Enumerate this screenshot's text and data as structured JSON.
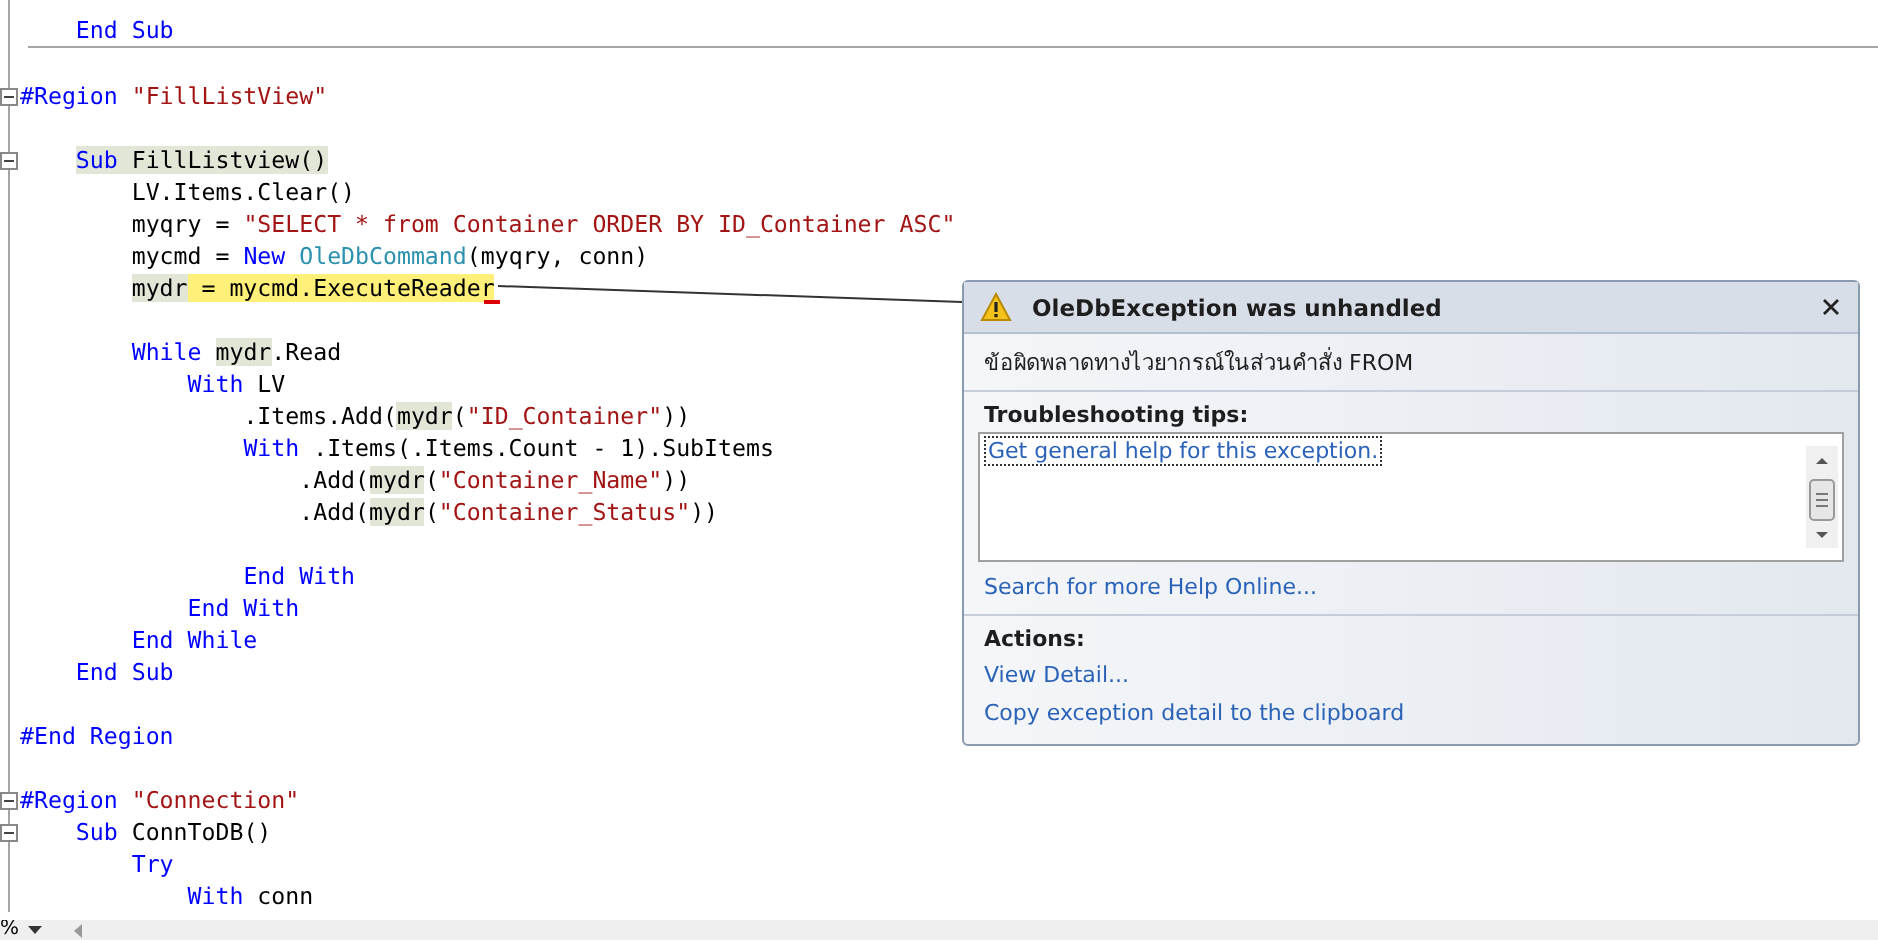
{
  "editor": {
    "lines": [
      {
        "separator_after": true,
        "tokens": [
          {
            "text": "    End Sub",
            "kind": "kw"
          }
        ]
      },
      {
        "blank_before": true,
        "fold": true,
        "tokens": [
          {
            "text": "#Region ",
            "kind": "kw"
          },
          {
            "text": "\"FillListView\"",
            "kind": "str"
          }
        ]
      },
      {
        "blank_before": true,
        "fold": true,
        "tokens": [
          {
            "text": "    Sub",
            "kind": "kw-ref"
          },
          {
            "text": " FillListview()",
            "kind": "ref"
          }
        ]
      },
      {
        "tokens": [
          {
            "text": "        LV.Items.Clear()",
            "kind": "plain"
          }
        ]
      },
      {
        "tokens": [
          {
            "text": "        myqry = ",
            "kind": "plain"
          },
          {
            "text": "\"SELECT * from Container ORDER BY ID_Container ASC\"",
            "kind": "str"
          }
        ]
      },
      {
        "tokens": [
          {
            "text": "        mycmd = ",
            "kind": "plain"
          },
          {
            "text": "New ",
            "kind": "kw"
          },
          {
            "text": "OleDbCommand",
            "kind": "type"
          },
          {
            "text": "(myqry, conn)",
            "kind": "plain"
          }
        ]
      },
      {
        "tokens": [
          {
            "text": "        mydr",
            "kind": "ref"
          },
          {
            "text": " = mycmd.",
            "kind": "current"
          },
          {
            "text": "ExecuteReader",
            "kind": "current-tagged"
          }
        ]
      },
      {
        "blank_before": true,
        "tokens": [
          {
            "text": "        While ",
            "kind": "kw"
          },
          {
            "text": "mydr",
            "kind": "ref"
          },
          {
            "text": ".Read",
            "kind": "plain"
          }
        ]
      },
      {
        "tokens": [
          {
            "text": "            With",
            "kind": "kw"
          },
          {
            "text": " LV",
            "kind": "plain"
          }
        ]
      },
      {
        "tokens": [
          {
            "text": "                .Items.Add(",
            "kind": "plain"
          },
          {
            "text": "mydr",
            "kind": "ref"
          },
          {
            "text": "(",
            "kind": "plain"
          },
          {
            "text": "\"ID_Container\"",
            "kind": "str"
          },
          {
            "text": "))",
            "kind": "plain"
          }
        ]
      },
      {
        "tokens": [
          {
            "text": "                With",
            "kind": "kw"
          },
          {
            "text": " .Items(.Items.Count - 1).SubItems",
            "kind": "plain"
          }
        ]
      },
      {
        "tokens": [
          {
            "text": "                    .Add(",
            "kind": "plain"
          },
          {
            "text": "mydr",
            "kind": "ref"
          },
          {
            "text": "(",
            "kind": "plain"
          },
          {
            "text": "\"Container_Name\"",
            "kind": "str"
          },
          {
            "text": "))",
            "kind": "plain"
          }
        ]
      },
      {
        "tokens": [
          {
            "text": "                    .Add(",
            "kind": "plain"
          },
          {
            "text": "mydr",
            "kind": "ref"
          },
          {
            "text": "(",
            "kind": "plain"
          },
          {
            "text": "\"Container_Status\"",
            "kind": "str"
          },
          {
            "text": "))",
            "kind": "plain"
          }
        ]
      },
      {
        "blank_before": true,
        "tokens": [
          {
            "text": "                End With",
            "kind": "kw"
          }
        ]
      },
      {
        "tokens": [
          {
            "text": "            End With",
            "kind": "kw"
          }
        ]
      },
      {
        "tokens": [
          {
            "text": "        End While",
            "kind": "kw"
          }
        ]
      },
      {
        "tokens": [
          {
            "text": "    End Sub",
            "kind": "kw"
          }
        ]
      },
      {
        "blank_before": true,
        "tokens": [
          {
            "text": "#End Region",
            "kind": "kw"
          }
        ]
      },
      {
        "blank_before": true,
        "fold": true,
        "tokens": [
          {
            "text": "#Region ",
            "kind": "kw"
          },
          {
            "text": "\"Connection\"",
            "kind": "str"
          }
        ]
      },
      {
        "fold": true,
        "tokens": [
          {
            "text": "    Sub",
            "kind": "kw"
          },
          {
            "text": " ConnToDB()",
            "kind": "plain"
          }
        ]
      },
      {
        "tokens": [
          {
            "text": "        Try",
            "kind": "kw"
          }
        ]
      },
      {
        "tokens": [
          {
            "text": "            With",
            "kind": "kw"
          },
          {
            "text": " conn",
            "kind": "plain"
          }
        ]
      }
    ]
  },
  "exception": {
    "title": "OleDbException was unhandled",
    "message": "ข้อผิดพลาดทางไวยากรณ์ในส่วนคำสั่ง FROM",
    "tips_heading": "Troubleshooting tips:",
    "tips": [
      {
        "label": "Get general help for this exception.",
        "selected": true
      }
    ],
    "help_link": "Search for more Help Online...",
    "actions_heading": "Actions:",
    "actions": [
      "View Detail...",
      "Copy exception detail to the clipboard"
    ]
  },
  "status_bar": {
    "zoom": "%"
  }
}
